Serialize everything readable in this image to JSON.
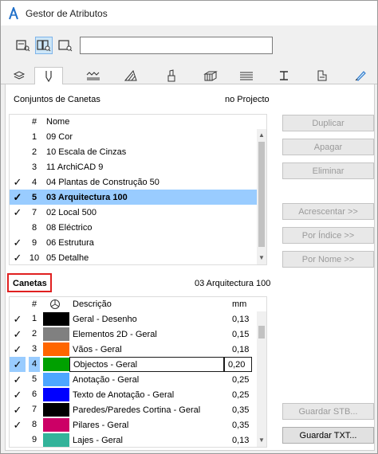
{
  "window": {
    "title": "Gestor de Atributos"
  },
  "toolbar": {
    "buttons": [
      {
        "icon": "view-list-icon",
        "active": false
      },
      {
        "icon": "view-compare-icon",
        "active": true
      },
      {
        "icon": "view-single-icon",
        "active": false
      }
    ],
    "search_value": ""
  },
  "tabs": [
    {
      "icon": "layers-icon",
      "active": false
    },
    {
      "icon": "pen-icon",
      "active": true
    },
    {
      "icon": "line-types-icon",
      "active": false
    },
    {
      "icon": "fills-icon",
      "active": false
    },
    {
      "icon": "building-materials-icon",
      "active": false
    },
    {
      "icon": "composites-icon",
      "active": false
    },
    {
      "icon": "profiles-icon",
      "active": false
    },
    {
      "icon": "zone-categories-icon",
      "active": false
    },
    {
      "icon": "surfaces-icon",
      "active": false
    },
    {
      "icon": "markup-icon",
      "active": false
    },
    {
      "icon": "paint-icon",
      "active": false
    }
  ],
  "pen_sets": {
    "title": "Conjuntos de Canetas",
    "location": "no Projecto",
    "headers": {
      "num": "#",
      "name": "Nome"
    },
    "rows": [
      {
        "checked": false,
        "num": "1",
        "name": "09 Cor",
        "selected": false
      },
      {
        "checked": false,
        "num": "2",
        "name": "10 Escala de Cinzas",
        "selected": false
      },
      {
        "checked": false,
        "num": "3",
        "name": "11 ArchiCAD 9",
        "selected": false
      },
      {
        "checked": true,
        "num": "4",
        "name": "04 Plantas de Construção 50",
        "selected": false
      },
      {
        "checked": true,
        "num": "5",
        "name": "03 Arquitectura 100",
        "selected": true
      },
      {
        "checked": true,
        "num": "7",
        "name": "02 Local 500",
        "selected": false
      },
      {
        "checked": false,
        "num": "8",
        "name": "08 Eléctrico",
        "selected": false
      },
      {
        "checked": true,
        "num": "9",
        "name": "06 Estrutura",
        "selected": false
      },
      {
        "checked": true,
        "num": "10",
        "name": "05 Detalhe",
        "selected": false
      }
    ]
  },
  "buttons": {
    "duplicar": "Duplicar",
    "apagar": "Apagar",
    "eliminar": "Eliminar",
    "acrescentar": "Acrescentar >>",
    "por_indice": "Por Índice >>",
    "por_nome": "Por Nome >>",
    "guardar_stb": "Guardar STB...",
    "guardar_txt": "Guardar TXT..."
  },
  "pens": {
    "title": "Canetas",
    "current_set": "03 Arquitectura 100",
    "headers": {
      "num": "#",
      "color_icon": "color-wheel-icon",
      "desc": "Descrição",
      "mm": "mm"
    },
    "rows": [
      {
        "checked": true,
        "num": "1",
        "color": "#000000",
        "desc": "Geral - Desenho",
        "mm": "0,13",
        "editing": false
      },
      {
        "checked": true,
        "num": "2",
        "color": "#808080",
        "desc": "Elementos 2D - Geral",
        "mm": "0,15",
        "editing": false
      },
      {
        "checked": true,
        "num": "3",
        "color": "#ff6600",
        "desc": "Vãos - Geral",
        "mm": "0,18",
        "editing": false
      },
      {
        "checked": true,
        "num": "4",
        "color": "#00a000",
        "desc": "Objectos - Geral",
        "mm": "0,20",
        "editing": true
      },
      {
        "checked": true,
        "num": "5",
        "color": "#4da6ff",
        "desc": "Anotação - Geral",
        "mm": "0,25",
        "editing": false
      },
      {
        "checked": true,
        "num": "6",
        "color": "#0000ff",
        "desc": "Texto de Anotação - Geral",
        "mm": "0,25",
        "editing": false
      },
      {
        "checked": true,
        "num": "7",
        "color": "#000000",
        "desc": "Paredes/Paredes Cortina - Geral",
        "mm": "0,35",
        "editing": false
      },
      {
        "checked": true,
        "num": "8",
        "color": "#cc0066",
        "desc": "Pilares - Geral",
        "mm": "0,35",
        "editing": false
      },
      {
        "checked": false,
        "num": "9",
        "color": "#33b39a",
        "desc": "Lajes - Geral",
        "mm": "0,13",
        "editing": false
      }
    ]
  },
  "colors": {
    "selection": "#99ccff",
    "highlight_box": "#e02020",
    "active_tab_border": "#7eb4ea"
  }
}
